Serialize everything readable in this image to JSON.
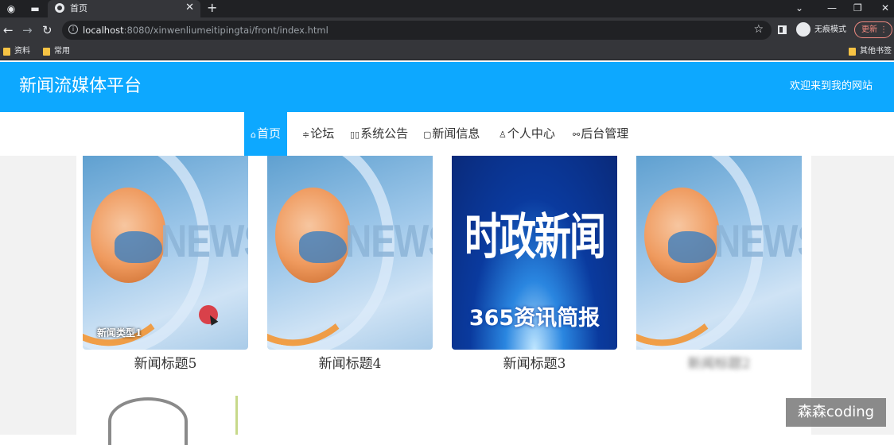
{
  "browser": {
    "tab_title": "首页",
    "url_host": "localhost",
    "url_rest": ":8080/xinwenliumeitipingtai/front/index.html",
    "incognito_label": "无痕模式",
    "update_label": "更新",
    "bookmarks": [
      "资料",
      "常用"
    ],
    "other_bookmarks": "其他书签"
  },
  "header": {
    "site_title": "新闻流媒体平台",
    "welcome": "欢迎来到我的网站"
  },
  "nav": {
    "items": [
      {
        "icon": "⌂",
        "label": "首页",
        "active": true
      },
      {
        "icon": "≑",
        "label": "论坛"
      },
      {
        "icon": "▯▯",
        "label": "系统公告"
      },
      {
        "icon": "▢",
        "label": "新闻信息"
      },
      {
        "icon": "♙",
        "label": "个人中心"
      },
      {
        "icon": "⚯",
        "label": "后台管理"
      }
    ]
  },
  "news_cards": [
    {
      "title": "新闻标题5",
      "image": "news-globe",
      "overlay_label": "新闻类型1"
    },
    {
      "title": "新闻标题4",
      "image": "news-globe"
    },
    {
      "title": "新闻标题3",
      "image": "politics-news",
      "image_text": "时政新闻",
      "image_subtext": "365资讯简报"
    },
    {
      "title": "新闻标题2",
      "image": "news-globe",
      "blurred": true
    }
  ],
  "image_word": "NEWS",
  "watermark": "森森coding",
  "colors": {
    "accent": "#0da8ff",
    "tab_bg": "#35363a",
    "chrome_bg": "#202124"
  }
}
